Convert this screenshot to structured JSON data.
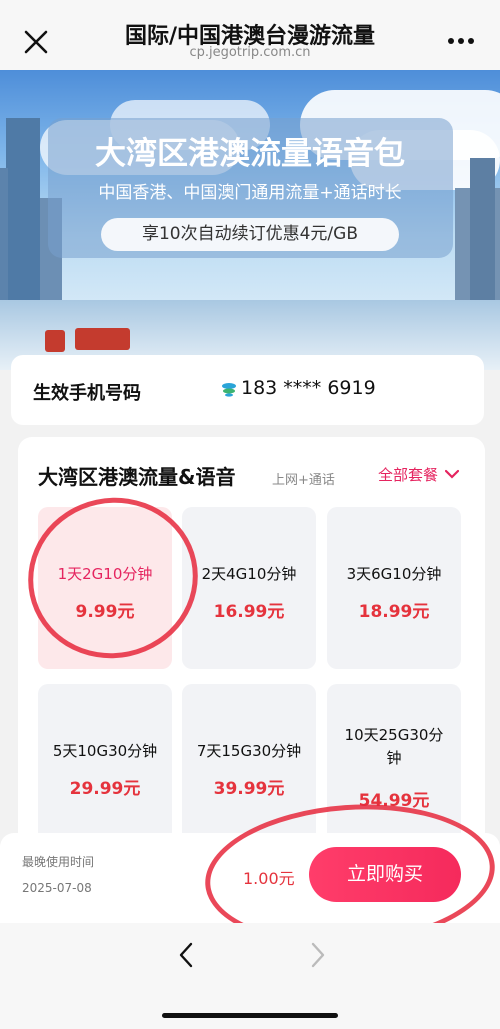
{
  "header": {
    "title": "国际/中国港澳台漫游流量",
    "url": "cp.jegotrip.com.cn"
  },
  "banner": {
    "headline": "大湾区港澳流量语音包",
    "subline": "中国香港、中国澳门通用流量+通话时长",
    "promo": "享10次自动续订优惠4元/GB"
  },
  "phone": {
    "label": "生效手机号码",
    "number": "183 **** 6919"
  },
  "plans": {
    "title": "大湾区港澳流量&语音",
    "tag": "上网+通话",
    "all_label": "全部套餐",
    "items": [
      {
        "name": "1天2G10分钟",
        "price": "9.99元",
        "selected": true
      },
      {
        "name": "2天4G10分钟",
        "price": "16.99元",
        "selected": false
      },
      {
        "name": "3天6G10分钟",
        "price": "18.99元",
        "selected": false
      },
      {
        "name": "5天10G30分钟",
        "price": "29.99元",
        "selected": false
      },
      {
        "name": "7天15G30分钟",
        "price": "39.99元",
        "selected": false
      },
      {
        "name": "10天25G30分钟",
        "price": "54.99元",
        "selected": false
      }
    ]
  },
  "checkout": {
    "deadline_label": "最晚使用时间",
    "deadline_date": "2025-07-08",
    "total": "1.00元",
    "buy_label": "立即购买"
  },
  "colors": {
    "accent": "#e5245f",
    "price": "#e5333d",
    "selected_bg": "#fde8ea",
    "annotation_ring": "#e6283c"
  },
  "icons": [
    "close-icon",
    "more-icon",
    "sim-card-icon",
    "chevron-down-icon",
    "back-arrow-icon",
    "forward-arrow-icon"
  ]
}
